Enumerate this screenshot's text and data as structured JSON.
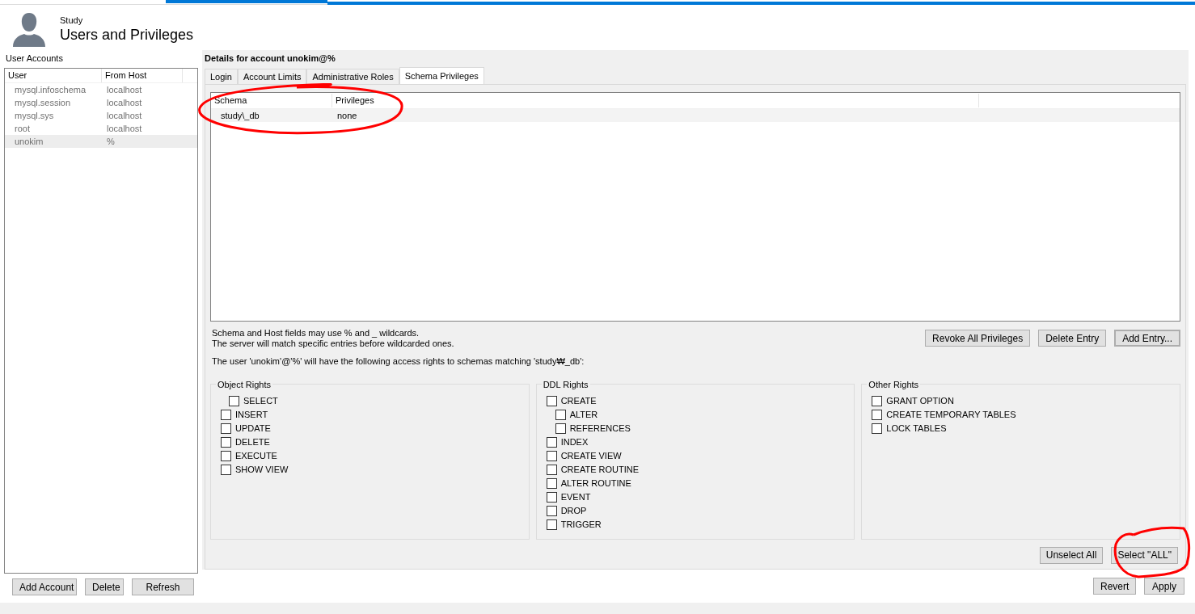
{
  "header": {
    "subtitle": "Study",
    "title": "Users and Privileges"
  },
  "accounts": {
    "label": "User Accounts",
    "columns": [
      "User",
      "From Host"
    ],
    "rows": [
      {
        "user": "mysql.infoschema",
        "host": "localhost",
        "selected": false
      },
      {
        "user": "mysql.session",
        "host": "localhost",
        "selected": false
      },
      {
        "user": "mysql.sys",
        "host": "localhost",
        "selected": false
      },
      {
        "user": "root",
        "host": "localhost",
        "selected": false
      },
      {
        "user": "unokim",
        "host": "%",
        "selected": true
      }
    ],
    "buttons": [
      "Add Account",
      "Delete",
      "Refresh"
    ]
  },
  "details": {
    "title": "Details for account unokim@%",
    "tabs": [
      {
        "label": "Login",
        "selected": false
      },
      {
        "label": "Account Limits",
        "selected": false
      },
      {
        "label": "Administrative Roles",
        "selected": false
      },
      {
        "label": "Schema Privileges",
        "selected": true
      }
    ],
    "schema_table": {
      "columns": [
        "Schema",
        "Privileges"
      ],
      "rows": [
        {
          "schema": "study\\_db",
          "privileges": "none"
        }
      ]
    },
    "hint": [
      "Schema and Host fields may use % and _ wildcards.",
      "The server will match specific entries before wildcarded ones."
    ],
    "entry_buttons": [
      {
        "label": "Revoke All Privileges",
        "default": false
      },
      {
        "label": "Delete Entry",
        "default": false
      },
      {
        "label": "Add Entry...",
        "default": true
      }
    ],
    "access_note": "The user 'unokim'@'%' will have the following access rights to schemas matching 'study₩_db':",
    "groups": [
      {
        "title": "Object Rights",
        "items": [
          {
            "label": "SELECT",
            "checked": false
          },
          {
            "label": "INSERT",
            "checked": false
          },
          {
            "label": "UPDATE",
            "checked": false
          },
          {
            "label": "DELETE",
            "checked": false
          },
          {
            "label": "EXECUTE",
            "checked": false
          },
          {
            "label": "SHOW VIEW",
            "checked": false
          }
        ]
      },
      {
        "title": "DDL Rights",
        "items": [
          {
            "label": "CREATE",
            "checked": false,
            "children": [
              {
                "label": "ALTER",
                "checked": false
              },
              {
                "label": "REFERENCES",
                "checked": false
              }
            ]
          },
          {
            "label": "INDEX",
            "checked": false
          },
          {
            "label": "CREATE VIEW",
            "checked": false
          },
          {
            "label": "CREATE ROUTINE",
            "checked": false
          },
          {
            "label": "ALTER ROUTINE",
            "checked": false
          },
          {
            "label": "EVENT",
            "checked": false
          },
          {
            "label": "DROP",
            "checked": false
          },
          {
            "label": "TRIGGER",
            "checked": false
          }
        ]
      },
      {
        "title": "Other Rights",
        "items": [
          {
            "label": "GRANT OPTION",
            "checked": false
          },
          {
            "label": "CREATE TEMPORARY TABLES",
            "checked": false
          },
          {
            "label": "LOCK TABLES",
            "checked": false
          }
        ]
      }
    ],
    "select_buttons": [
      "Unselect All",
      "Select \"ALL\""
    ],
    "footer_buttons": [
      "Revert",
      "Apply"
    ]
  }
}
